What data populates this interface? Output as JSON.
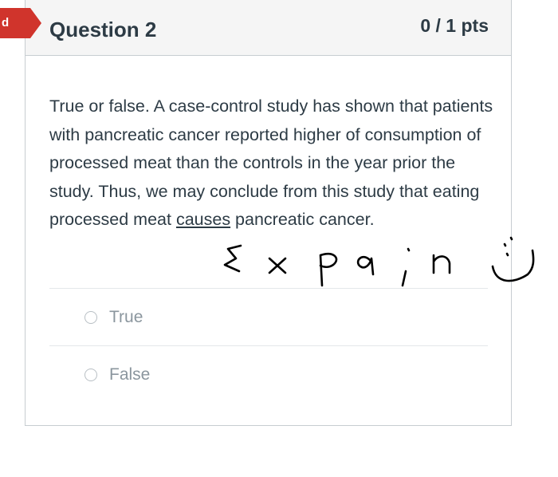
{
  "flag": {
    "label": "d"
  },
  "question": {
    "title": "Question 2",
    "points": "0 / 1 pts",
    "text_before": "True or false. A case-control study has shown that patients with pancreatic cancer reported higher of consumption of processed meat than the controls in the year prior the study. Thus, we may conclude from this study that eating processed meat ",
    "text_underlined": "causes",
    "text_after": " pancreatic cancer.",
    "answers": [
      {
        "label": "True",
        "selected": false
      },
      {
        "label": "False",
        "selected": false
      }
    ]
  },
  "annotation": {
    "handwritten_text": "Expain",
    "color": "#000000"
  },
  "colors": {
    "flag": "#d0342c",
    "header_bg": "#f5f5f5",
    "text": "#2d3b45",
    "answer_text": "#8b969e",
    "border": "#c7cdd1"
  }
}
